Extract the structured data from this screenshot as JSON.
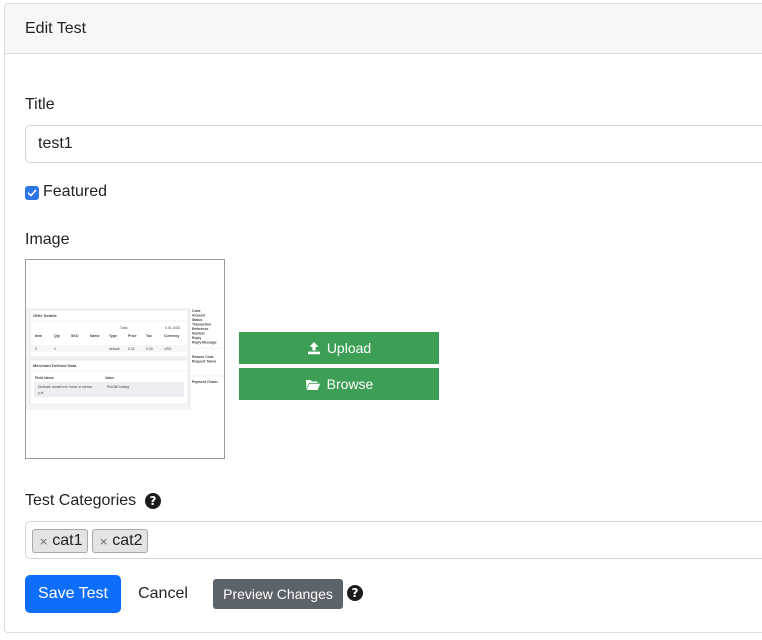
{
  "header": {
    "title": "Edit Test"
  },
  "form": {
    "title_label": "Title",
    "title_value": "test1",
    "featured_label": "Featured",
    "featured_checked": true,
    "image_label": "Image",
    "upload_label": "Upload",
    "browse_label": "Browse",
    "categories_label": "Test Categories",
    "categories": [
      "cat1",
      "cat2"
    ],
    "tag_remove_symbol": "×",
    "help_symbol": "?"
  },
  "thumbnail": {
    "offer_details": "Offer Details",
    "total_label": "Total",
    "total_value": "0.01 USD",
    "columns": [
      "Item",
      "Qty",
      "SKU",
      "Name",
      "Type",
      "Price",
      "Tax",
      "Currency"
    ],
    "row": [
      "0",
      "1",
      "",
      "",
      "default",
      "0.01",
      "0.00",
      "USD"
    ],
    "merchant_heading": "Merchant Defined Data",
    "field_name": "Field Name",
    "value": "Value",
    "note": "Dedicate donation in honor or memor",
    "note2": "y of",
    "note_value": "Pbn360 testing",
    "side_labels": [
      "Code",
      "Amount",
      "Status",
      "Transaction",
      "Reference",
      "Number",
      "Reply",
      "Reply Message",
      "",
      "Reason Code",
      "Request Token",
      "",
      "Payment Chann"
    ]
  },
  "actions": {
    "save_label": "Save Test",
    "cancel_label": "Cancel",
    "preview_label": "Preview Changes"
  },
  "colors": {
    "primary": "#0d6efd",
    "green": "#3d9e55",
    "secondary": "#5c636a"
  }
}
